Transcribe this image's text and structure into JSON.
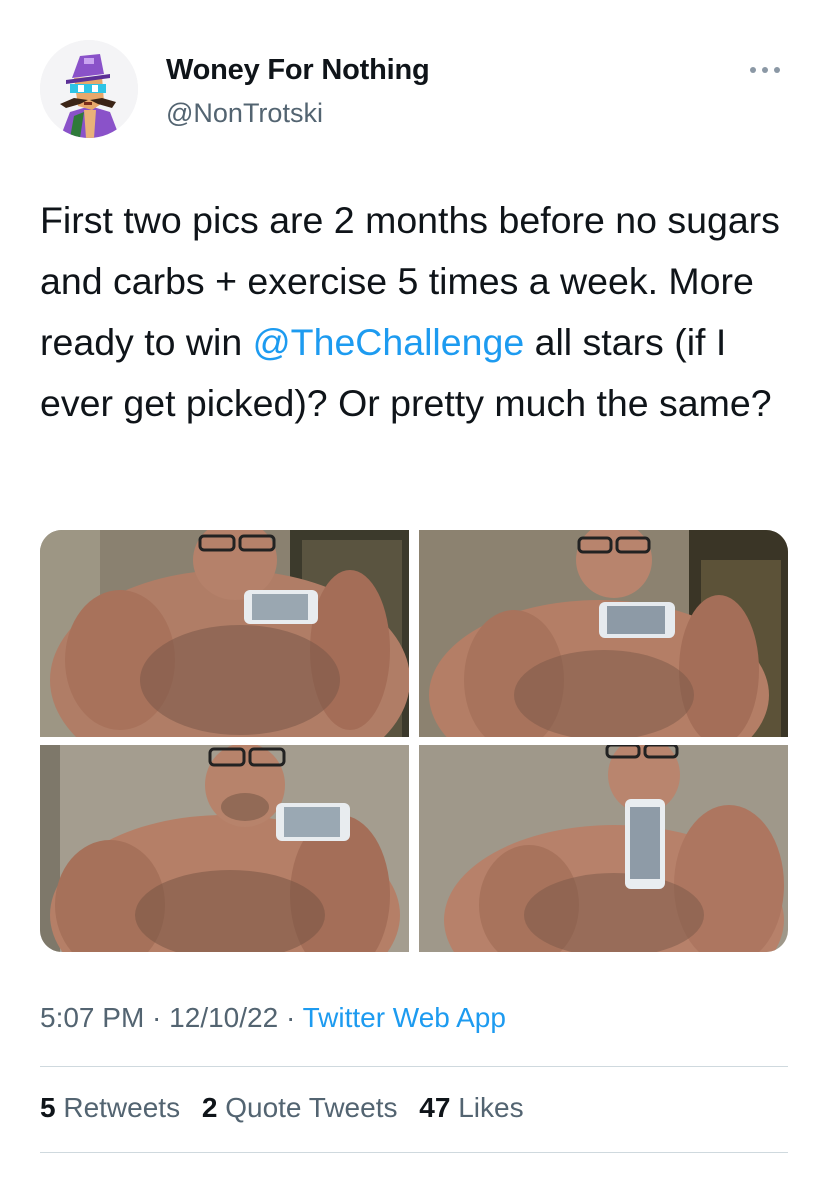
{
  "author": {
    "display_name": "Woney For Nothing",
    "handle": "@NonTrotski",
    "avatar_icon": "cartoon-avatar-icon"
  },
  "tweet": {
    "text_before": "First two pics are 2 months before no sugars and carbs + exercise 5 times a week. More ready to win ",
    "mention": "@TheChallenge",
    "text_after": " all stars (if I ever get picked)?  Or pretty much the same?"
  },
  "media": {
    "count": 4,
    "description_icon": "photo-grid"
  },
  "meta": {
    "time": "5:07 PM",
    "sep1": " · ",
    "date": "12/10/22",
    "sep2": " · ",
    "source": "Twitter Web App"
  },
  "stats": {
    "retweets_count": "5",
    "retweets_label": "Retweets",
    "quotes_count": "2",
    "quotes_label": "Quote Tweets",
    "likes_count": "47",
    "likes_label": "Likes"
  },
  "colors": {
    "link": "#1d9bf0",
    "secondary_text": "#536471",
    "primary_text": "#0f1419",
    "divider": "#cfd9de"
  }
}
